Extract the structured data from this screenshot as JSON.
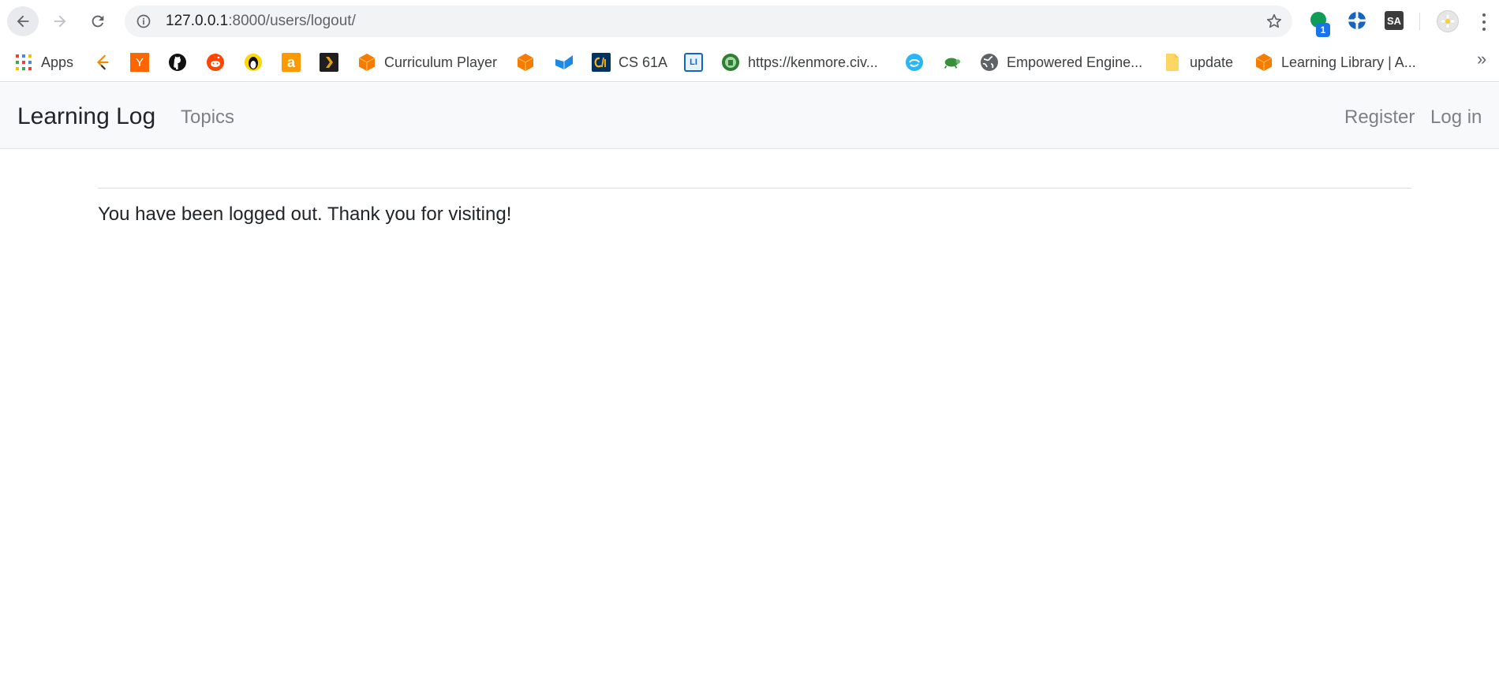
{
  "browser": {
    "url_host": "127.0.0.1",
    "url_rest": ":8000/users/logout/",
    "extension_badge": "1",
    "extensions": [
      "chat-extension-icon",
      "lifesaver-extension-icon",
      "sa-extension-icon"
    ],
    "extension_sa_label": "SA",
    "yc_letter": "Y",
    "amazon_letter": "a",
    "li_label": "LI",
    "bookmarks": {
      "apps": "Apps",
      "curriculum": "Curriculum Player",
      "cs61a": "CS 61A",
      "kenmore": "https://kenmore.civ...",
      "empowered": "Empowered Engine...",
      "update": "update",
      "library": "Learning Library | A..."
    },
    "more_bookmarks": "»"
  },
  "site": {
    "brand": "Learning Log",
    "nav_topics": "Topics",
    "nav_register": "Register",
    "nav_login": "Log in"
  },
  "content": {
    "message": "You have been logged out. Thank you for visiting!"
  },
  "colors": {
    "navbar_bg": "#f8f9fa",
    "nav_link": "#7d8186",
    "brand_text": "#212529"
  }
}
